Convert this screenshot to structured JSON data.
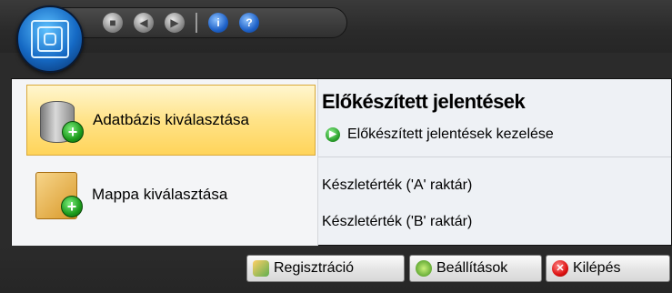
{
  "quick_access": {
    "icons": [
      "cube-icon",
      "back-icon",
      "forward-icon",
      "info-icon",
      "help-icon"
    ],
    "info_glyph": "i",
    "help_glyph": "?"
  },
  "sidebar": {
    "items": [
      {
        "label": "Adatbázis kiválasztása",
        "icon": "database-add-icon"
      },
      {
        "label": "Mappa kiválasztása",
        "icon": "folder-add-icon"
      }
    ]
  },
  "reports": {
    "title": "Előkészített jelentések",
    "manage_label": "Előkészített jelentések kezelése",
    "items": [
      "Készletérték ('A' raktár)",
      "Készletérték ('B' raktár)"
    ]
  },
  "footer": {
    "register_label": "Regisztráció",
    "settings_label": "Beállítások",
    "exit_label": "Kilépés"
  },
  "colors": {
    "active_item": "#ffe388",
    "panel_bg": "#eef1f5",
    "chrome_bg": "#2b2b2b"
  }
}
